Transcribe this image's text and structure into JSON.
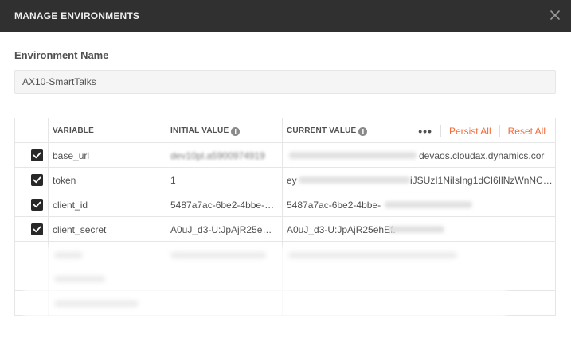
{
  "dialog": {
    "title": "MANAGE ENVIRONMENTS"
  },
  "environment": {
    "label": "Environment Name",
    "name_value": "AX10-SmartTalks"
  },
  "table": {
    "columns": {
      "variable": "VARIABLE",
      "initial_value": "INITIAL VALUE",
      "current_value": "CURRENT VALUE"
    },
    "actions": {
      "more": "•••",
      "persist_all": "Persist All",
      "reset_all": "Reset All"
    },
    "rows": [
      {
        "checked": true,
        "variable": "base_url",
        "initial_value": "dev10pl.a5900974919",
        "current_value": "devaos.cloudax.dynamics.cor"
      },
      {
        "checked": true,
        "variable": "token",
        "initial_value": "1",
        "current_value": "ey",
        "current_value_tail": "iJSUzI1NiIsIng1dCI6IlNzWnNC…"
      },
      {
        "checked": true,
        "variable": "client_id",
        "initial_value": "5487a7ac-6be2-4bbe-…",
        "current_value": "5487a7ac-6be2-4bbe-"
      },
      {
        "checked": true,
        "variable": "client_secret",
        "initial_value": "A0uJ_d3-U:JpAjR25ehE…",
        "current_value": "A0uJ_d3-U:JpAjR25ehEf."
      }
    ]
  },
  "icons": {
    "close": "close-icon",
    "info": "info-icon",
    "check": "check-icon"
  },
  "colors": {
    "titlebar": "#303030",
    "accent": "#f26b3a",
    "checkbox": "#282828"
  }
}
